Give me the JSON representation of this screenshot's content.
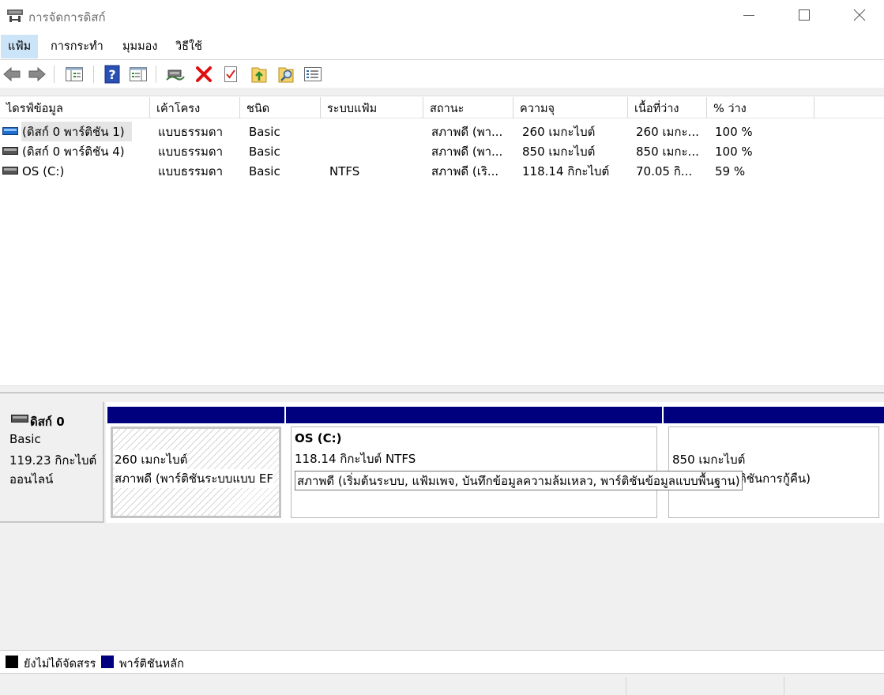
{
  "window": {
    "title": "การจัดการดิสก์",
    "icon": "disk-management-icon"
  },
  "menu": [
    {
      "label": "แฟ้ม",
      "active": true
    },
    {
      "label": "การกระทำ"
    },
    {
      "label": "มุมมอง"
    },
    {
      "label": "วิธีใช้"
    }
  ],
  "toolbar": {
    "icons": [
      "back-arrow-icon",
      "forward-arrow-icon",
      "console-tree-icon",
      "help-icon",
      "show-action-pane-icon",
      "connect-drive-icon",
      "delete-icon",
      "properties-check-icon",
      "import-folder-icon",
      "search-folder-icon",
      "list-view-icon"
    ]
  },
  "volume_list": {
    "columns": [
      "ไดรฟ์ข้อมูล",
      "เค้าโครง",
      "ชนิด",
      "ระบบแฟ้ม",
      "สถานะ",
      "ความจุ",
      "เนื้อที่ว่าง",
      "% ว่าง"
    ],
    "rows": [
      {
        "volume": "(ดิสก์ 0 พาร์ติชัน 1)",
        "layout": "แบบธรรมดา",
        "type": "Basic",
        "fs": "",
        "status": "สภาพดี (พา...",
        "capacity": "260 เมกะไบต์",
        "free": "260 เมกะ...",
        "pct": "100 %",
        "selected": true
      },
      {
        "volume": "(ดิสก์ 0 พาร์ติชัน 4)",
        "layout": "แบบธรรมดา",
        "type": "Basic",
        "fs": "",
        "status": "สภาพดี (พา...",
        "capacity": "850 เมกะไบต์",
        "free": "850 เมกะ...",
        "pct": "100 %"
      },
      {
        "volume": "OS (C:)",
        "layout": "แบบธรรมดา",
        "type": "Basic",
        "fs": "NTFS",
        "status": "สภาพดี (เริ...",
        "capacity": "118.14 กิกะไบต์",
        "free": "70.05 กิ...",
        "pct": "59 %"
      }
    ]
  },
  "disk": {
    "name": "ดิสก์ 0",
    "type": "Basic",
    "size": "119.23 กิกะไบต์",
    "state": "ออนไลน์",
    "partitions": [
      {
        "title": "",
        "size": "260 เมกะไบต์",
        "status": "สภาพดี (พาร์ติชันระบบแบบ EF"
      },
      {
        "title": "OS  (C:)",
        "size": "118.14 กิกะไบต์ NTFS",
        "status": "สภาพดี (เริ่มต้นระบบ, แฟ้มเพจ, บันทึกข้อมูลความล้มเหลว, พาร์ติชันข้อมูลแบบพื้นฐาน)"
      },
      {
        "title": "",
        "size": "850 เมกะไบต์",
        "status": "ติชันการกู้คืน)"
      }
    ]
  },
  "legend": [
    {
      "label": "ยังไม่ได้จัดสรร",
      "color": "#000000"
    },
    {
      "label": "พาร์ติชันหลัก",
      "color": "#00007f"
    }
  ],
  "colors": {
    "partition_bar": "#00007f",
    "menu_highlight": "#cce4f7",
    "delete_red": "#e01010"
  }
}
